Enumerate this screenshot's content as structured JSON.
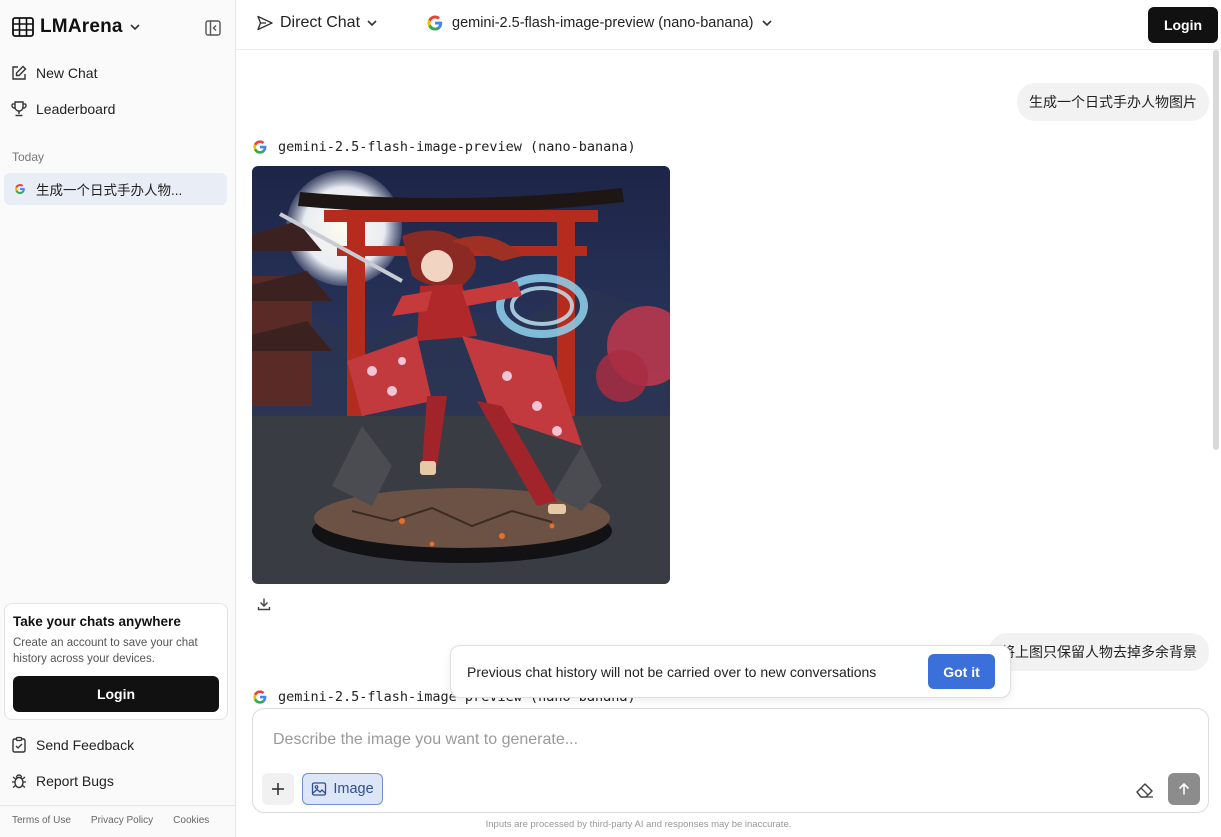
{
  "sidebar": {
    "brand": "LMArena",
    "nav": [
      {
        "label": "New Chat",
        "icon": "edit-icon"
      },
      {
        "label": "Leaderboard",
        "icon": "trophy-icon"
      }
    ],
    "section_label": "Today",
    "history": [
      {
        "label": "生成一个日式手办人物...",
        "icon": "google-icon"
      }
    ],
    "promo": {
      "title": "Take your chats anywhere",
      "text": "Create an account to save your chat history across your devices.",
      "button": "Login"
    },
    "bottom_nav": [
      {
        "label": "Send Feedback",
        "icon": "feedback-icon"
      },
      {
        "label": "Report Bugs",
        "icon": "bug-icon"
      }
    ],
    "footer_links": [
      "Terms of Use",
      "Privacy Policy",
      "Cookies"
    ]
  },
  "header": {
    "mode": "Direct Chat",
    "model": "gemini-2.5-flash-image-preview (nano-banana)",
    "login": "Login"
  },
  "chat": {
    "messages": [
      {
        "role": "user",
        "text": "生成一个日式手办人物图片"
      },
      {
        "role": "model",
        "model_name": "gemini-2.5-flash-image-preview (nano-banana)",
        "content": "image"
      },
      {
        "role": "user",
        "text": "将上图只保留人物去掉多余背景"
      },
      {
        "role": "model",
        "model_name": "gemini-2.5-flash-image-preview (nano-banana)"
      }
    ]
  },
  "toast": {
    "text": "Previous chat history will not be carried over to new conversations",
    "button": "Got it"
  },
  "composer": {
    "placeholder": "Describe the image you want to generate...",
    "image_button": "Image",
    "disclaimer": "Inputs are processed by third-party AI and responses may be inaccurate."
  },
  "colors": {
    "accent": "#3b6fd9",
    "dark_button": "#111111",
    "history_selected": "#e9edf6"
  }
}
